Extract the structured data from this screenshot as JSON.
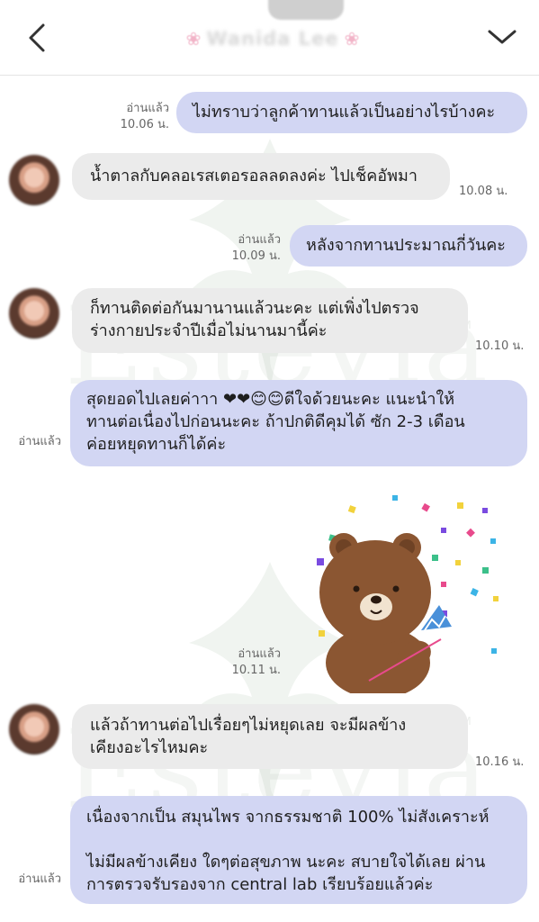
{
  "header": {
    "contact_name": "Wanida Lee",
    "name_decoration": "❀"
  },
  "watermark": {
    "text": "Estevia",
    "tm": "TM"
  },
  "messages": [
    {
      "side": "out",
      "text": "ไม่ทราบว่าลูกค้าทานแล้วเป็นอย่างไรบ้างคะ",
      "read": "อ่านแล้ว",
      "time": "10.06 น."
    },
    {
      "side": "in",
      "text": "น้ำตาลกับคลอเรสเตอรอลลดลงค่ะ ไปเช็คอัพมา",
      "time": "10.08 น."
    },
    {
      "side": "out",
      "text": "หลังจากทานประมาณกี่วันคะ",
      "read": "อ่านแล้ว",
      "time": "10.09 น."
    },
    {
      "side": "in",
      "text": "ก็ทานติดต่อกันมานานแล้วนะคะ แต่เพิ่งไปตรวจ\nร่างกายประจำปีเมื่อไม่นานมานี้ค่ะ",
      "time": "10.10 น."
    },
    {
      "side": "out",
      "text": "สุดยอดไปเลยค่าาา ❤❤😊😊ดีใจด้วยนะคะ แนะนำให้\nทานต่อเนื่องไปก่อนนะคะ ถ้าปกติดีคุมได้ ซัก 2-3 เดือน\nค่อยหยุดทานก็ได้ค่ะ",
      "read": "อ่านแล้ว"
    },
    {
      "side": "out",
      "type": "sticker",
      "sticker": "bear-party-popper",
      "read": "อ่านแล้ว",
      "time": "10.11 น."
    },
    {
      "side": "in",
      "text": "แล้วถ้าทานต่อไปเรื่อยๆไม่หยุดเลย จะมีผลข้าง\nเคียงอะไรไหมคะ",
      "time": "10.16 น."
    },
    {
      "side": "out",
      "text": "เนื่องจากเป็น สมุนไพร จากธรรมชาติ 100% ไม่สังเคราะห์\n\nไม่มีผลข้างเคียง ใดๆต่อสุขภาพ นะคะ สบายใจได้เลย ผ่าน\nการตรวจรับรองจาก central lab เรียบร้อยแล้วค่ะ",
      "read": "อ่านแล้ว"
    }
  ]
}
